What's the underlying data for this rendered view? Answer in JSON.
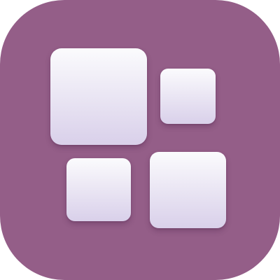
{
  "app_icon": {
    "icon": "widget-grid-icon",
    "background_color": "#945e88",
    "tile_top_color": "#fbfbfd",
    "tile_bottom_color": "#d9d0ea",
    "tiles": [
      {
        "name": "tile-large"
      },
      {
        "name": "tile-small"
      },
      {
        "name": "tile-medium"
      },
      {
        "name": "tile-xlarge"
      }
    ]
  }
}
